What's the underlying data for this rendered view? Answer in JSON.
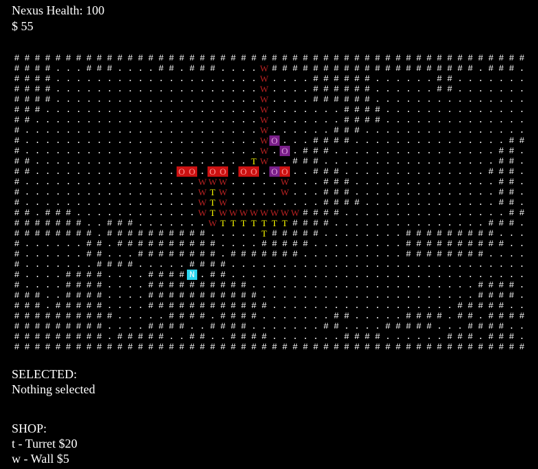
{
  "hud": {
    "nexus_health_label": "Nexus Health: 100",
    "money_label": "$ 55"
  },
  "selected": {
    "heading": "SELECTED:",
    "value": "Nothing selected"
  },
  "shop": {
    "heading": "SHOP:",
    "items": [
      {
        "key": "t",
        "label": "t - Turret $20"
      },
      {
        "key": "w",
        "label": "w - Wall $5"
      }
    ]
  },
  "legend": {
    "wall_tile": "#",
    "floor_tile": ".",
    "player_wall": "W",
    "turret": "T",
    "nexus": "N",
    "enemy": "O"
  },
  "colors": {
    "background": "#000000",
    "text": "#ffffff",
    "player_wall": "#bb2222",
    "turret": "#ffff00",
    "nexus_bg": "#2bd5f0",
    "enemy_red_bg": "#cc1111",
    "enemy_purple_bg": "#7a1f8a"
  },
  "map": {
    "rows": [
      "##################################################",
      "####...###....##.###....W####################.###....#",
      "####....................W....######......##.....",
      "####....................W....######......##.....",
      "####....................W....######............",
      "###.....................W.......####............",
      "##......................W.......####............",
      "#.......................W......###..............",
      "#.......................WO...####...............##",
      "#.......................W.O.###................##",
      "##.....................TW..###.................##",
      "##...............O..O..O..O..###..............###",
      "#.................WWW.....W...###..............##",
      "#.................WTW.....W...###..............##",
      "#.................WTW.........####.............##",
      "##.###............WTWWWWWWWW####................##",
      "#######..###.......WTTTTTTT####...............###",
      "########.##########.....T#####........#########.",
      "#......##.##########....#####.........##########",
      "#......##...########.#######..........########",
      "#.......####.....####..........................",
      "#....####....####N.##..........................",
      "#....####....##########......................####",
      "###..####....###########.....................####",
      "###.#####....############..................#####",
      "##########.....####.####.......##.....####.##.####",
      "#########....####..####.......##....#####...####",
      "#########.#####..##..####.......####......###.###",
      "##################################################"
    ],
    "enemies": [
      {
        "row": 8,
        "col": 25,
        "kind": "purple"
      },
      {
        "row": 9,
        "col": 26,
        "kind": "purple"
      },
      {
        "row": 11,
        "col": 16,
        "kind": "red"
      },
      {
        "row": 11,
        "col": 19,
        "kind": "red"
      },
      {
        "row": 11,
        "col": 22,
        "kind": "red"
      },
      {
        "row": 11,
        "col": 25,
        "kind": "purple"
      }
    ]
  }
}
